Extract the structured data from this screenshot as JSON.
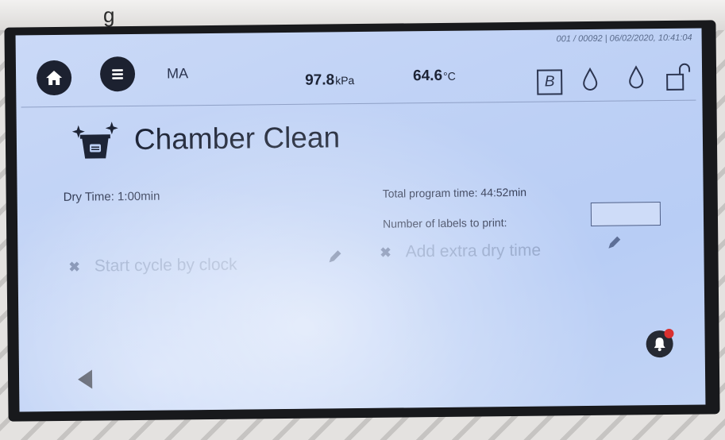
{
  "header": {
    "meta": "001 / 00092 | 06/02/2020, 10:41:04",
    "mode": "MA",
    "pressure_value": "97.8",
    "pressure_unit": "kPa",
    "temperature_value": "64.6",
    "temperature_unit": "°C",
    "b_indicator": "B"
  },
  "program": {
    "title": "Chamber Clean",
    "dry_time": "Dry Time: 1:00min",
    "total_time": "Total program time: 44:52min",
    "labels_to_print": "Number of labels to print:",
    "labels_value": ""
  },
  "options": {
    "start_cycle_by_clock": "Start cycle by clock",
    "add_extra_dry_time": "Add extra dry time",
    "disabled_mark": "✖"
  },
  "icons": {
    "home": "home-icon",
    "menu": "menu-icon",
    "drop": "water-drop-icon",
    "lock": "unlock-icon",
    "program": "chamber-clean-icon",
    "pencil": "pencil-icon",
    "back": "back-arrow-icon",
    "alarm": "alarm-bell-icon"
  },
  "colors": {
    "screen_bg": "#bdd0f5",
    "text_dark": "#1d2436",
    "disabled_text": "#8ea2c8",
    "alarm_red": "#d93030"
  }
}
